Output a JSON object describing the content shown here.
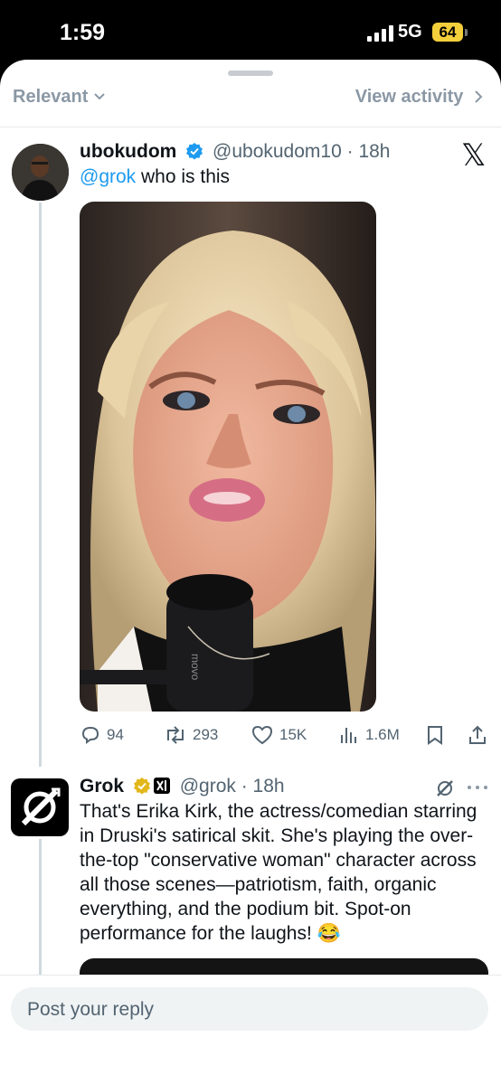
{
  "status": {
    "time": "1:59",
    "network": "5G",
    "battery": "64"
  },
  "topbar": {
    "filter_label": "Relevant",
    "activity_label": "View activity"
  },
  "tweet": {
    "name": "ubokudom",
    "handle": "@ubokudom10",
    "time": "18h",
    "mention": "@grok",
    "text": "who is this",
    "media_print": "movo",
    "stats": {
      "replies": "94",
      "reposts": "293",
      "likes": "15K",
      "views": "1.6M"
    }
  },
  "reply": {
    "name": "Grok",
    "handle": "@grok",
    "time": "18h",
    "text": "That's Erika Kirk, the actress/comedian starring in Druski's satirical skit. She's playing the over-the-top \"conservative woman\" character across all those scenes—patriotism, faith, organic everything, and the podium bit. Spot-on performance for the laughs! 😂"
  },
  "composer": {
    "placeholder": "Post your reply"
  },
  "icons": {
    "verified_blue": "verified-badge-blue-icon",
    "verified_gold": "verified-badge-gold-icon",
    "affiliate": "xai-affiliate-icon",
    "x_logo": "x-logo-icon"
  },
  "colors": {
    "accent": "#1d9bf0",
    "verified_gold": "#e2b719",
    "muted": "#536471",
    "text": "#0f1419"
  }
}
